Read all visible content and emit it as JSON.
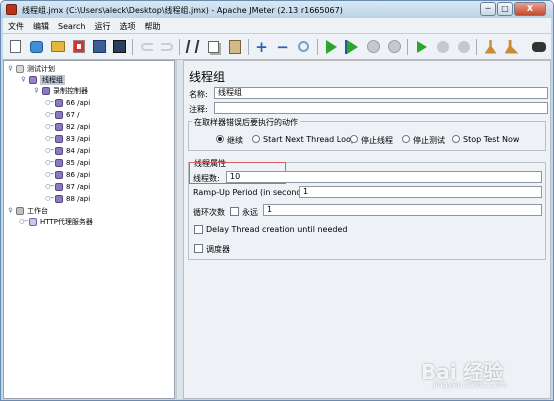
{
  "window": {
    "title": "线程组.jmx (C:\\Users\\aleck\\Desktop\\线程组.jmx) - Apache JMeter (2.13 r1665067)",
    "min": "─",
    "max": "□",
    "close": "X"
  },
  "menu": [
    "文件",
    "编辑",
    "Search",
    "运行",
    "选项",
    "帮助"
  ],
  "toolbar": [
    "new-icon",
    "template-icon",
    "open-icon",
    "close-file-icon",
    "save-icon",
    "save-as-icon",
    "undo-icon",
    "redo-icon",
    "cut-icon",
    "copy-icon",
    "paste-icon",
    "expand-icon",
    "collapse-icon",
    "toggle-icon",
    "start-icon",
    "start-no-pause-icon",
    "stop-icon",
    "shutdown-icon",
    "remote-start-icon",
    "remote-stop-icon",
    "remote-exit-icon",
    "clear-icon",
    "clear-all-icon",
    "search-icon"
  ],
  "tree": {
    "plan": "测试计划",
    "thread_group": "线程组",
    "controller": "录制控制器",
    "samplers": [
      "66 /api",
      "67 /",
      "82 /api",
      "83 /api",
      "84 /api",
      "85 /api",
      "86 /api",
      "87 /api",
      "88 /api"
    ],
    "workbench": "工作台",
    "proxy": "HTTP代理服务器"
  },
  "panel": {
    "header": "线程组",
    "name_label": "名称:",
    "name_value": "线程组",
    "comment_label": "注释:",
    "comment_value": "",
    "error_group_title": "在取样器错误后要执行的动作",
    "actions": [
      {
        "label": "继续",
        "selected": true
      },
      {
        "label": "Start Next Thread Loop",
        "selected": false
      },
      {
        "label": "停止线程",
        "selected": false
      },
      {
        "label": "停止测试",
        "selected": false
      },
      {
        "label": "Stop Test Now",
        "selected": false
      }
    ],
    "props_title": "线程属性",
    "threads_label": "线程数:",
    "threads_value": "10",
    "rampup_label": "Ramp-Up Period (in seconds):",
    "rampup_value": "1",
    "loop_label": "循环次数",
    "forever_label": "永远",
    "loop_value": "1",
    "delay_label": "Delay Thread creation until needed",
    "scheduler_label": "调度器"
  },
  "watermark": {
    "text": "Bai 经验",
    "sub": "jingyan.baidu.com"
  }
}
